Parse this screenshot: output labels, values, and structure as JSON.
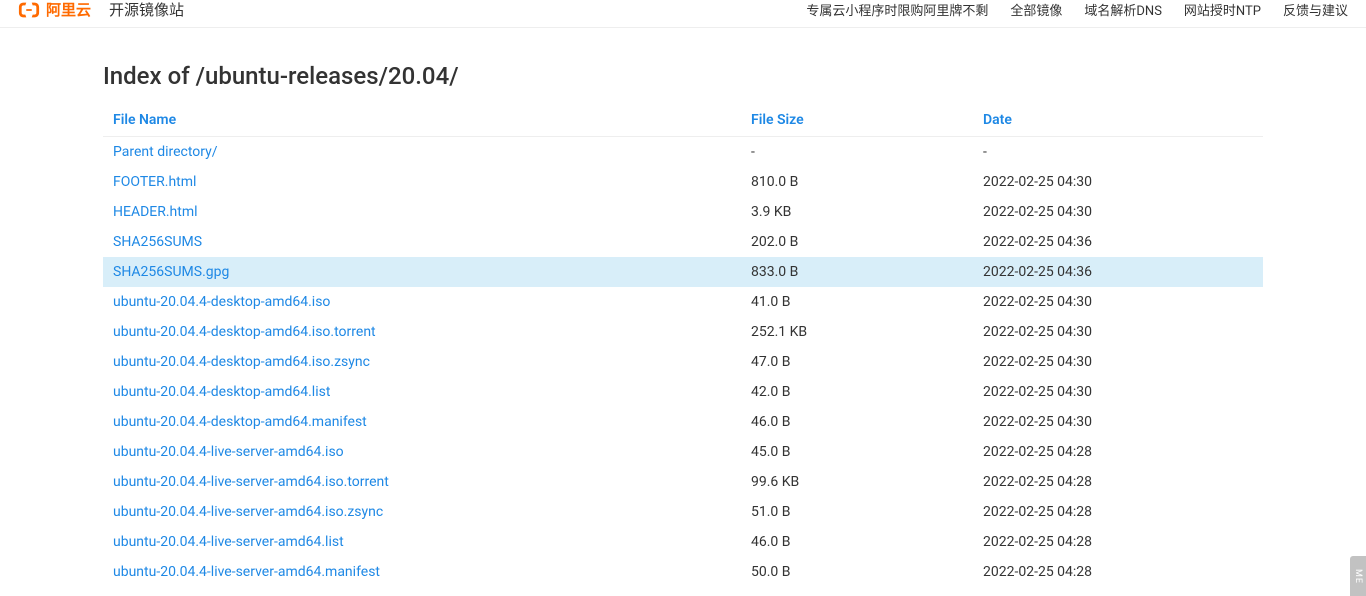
{
  "header": {
    "brand": "阿里云",
    "site_name": "开源镜像站",
    "nav": {
      "promo": "专属云小程序时限购阿里牌不剩",
      "allmirror": "全部镜像",
      "dns": "域名解析DNS",
      "ntp": "网站授时NTP",
      "feedback": "反馈与建议"
    }
  },
  "page": {
    "title": "Index of /ubuntu-releases/20.04/"
  },
  "columns": {
    "name": "File Name",
    "size": "File Size",
    "date": "Date"
  },
  "files": [
    {
      "name": "Parent directory/",
      "size": "-",
      "date": "-",
      "highlight": false
    },
    {
      "name": "FOOTER.html",
      "size": "810.0 B",
      "date": "2022-02-25 04:30",
      "highlight": false
    },
    {
      "name": "HEADER.html",
      "size": "3.9 KB",
      "date": "2022-02-25 04:30",
      "highlight": false
    },
    {
      "name": "SHA256SUMS",
      "size": "202.0 B",
      "date": "2022-02-25 04:36",
      "highlight": false
    },
    {
      "name": "SHA256SUMS.gpg",
      "size": "833.0 B",
      "date": "2022-02-25 04:36",
      "highlight": true
    },
    {
      "name": "ubuntu-20.04.4-desktop-amd64.iso",
      "size": "41.0 B",
      "date": "2022-02-25 04:30",
      "highlight": false
    },
    {
      "name": "ubuntu-20.04.4-desktop-amd64.iso.torrent",
      "size": "252.1 KB",
      "date": "2022-02-25 04:30",
      "highlight": false
    },
    {
      "name": "ubuntu-20.04.4-desktop-amd64.iso.zsync",
      "size": "47.0 B",
      "date": "2022-02-25 04:30",
      "highlight": false
    },
    {
      "name": "ubuntu-20.04.4-desktop-amd64.list",
      "size": "42.0 B",
      "date": "2022-02-25 04:30",
      "highlight": false
    },
    {
      "name": "ubuntu-20.04.4-desktop-amd64.manifest",
      "size": "46.0 B",
      "date": "2022-02-25 04:30",
      "highlight": false
    },
    {
      "name": "ubuntu-20.04.4-live-server-amd64.iso",
      "size": "45.0 B",
      "date": "2022-02-25 04:28",
      "highlight": false
    },
    {
      "name": "ubuntu-20.04.4-live-server-amd64.iso.torrent",
      "size": "99.6 KB",
      "date": "2022-02-25 04:28",
      "highlight": false
    },
    {
      "name": "ubuntu-20.04.4-live-server-amd64.iso.zsync",
      "size": "51.0 B",
      "date": "2022-02-25 04:28",
      "highlight": false
    },
    {
      "name": "ubuntu-20.04.4-live-server-amd64.list",
      "size": "46.0 B",
      "date": "2022-02-25 04:28",
      "highlight": false
    },
    {
      "name": "ubuntu-20.04.4-live-server-amd64.manifest",
      "size": "50.0 B",
      "date": "2022-02-25 04:28",
      "highlight": false
    }
  ],
  "side_tab": "ME"
}
